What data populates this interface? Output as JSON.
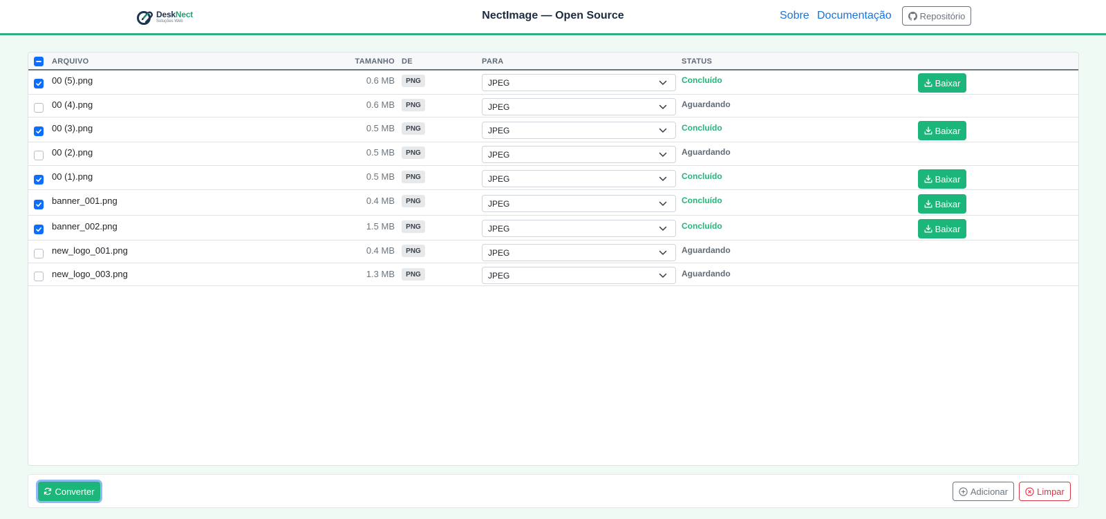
{
  "header": {
    "logo": {
      "name_part1": "Desk",
      "name_part2": "Nect",
      "subtitle": "Soluções Web"
    },
    "title": "NectImage — Open Source",
    "nav": {
      "sobre": "Sobre",
      "docs": "Documentação"
    },
    "repo_label": "Repositório"
  },
  "table": {
    "columns": {
      "file": "ARQUIVO",
      "size": "TAMANHO",
      "from": "DE",
      "to": "PARA",
      "status": "STATUS"
    },
    "rows": [
      {
        "name": "00 (5).png",
        "size": "0.6 MB",
        "from": "PNG",
        "to": "JPEG",
        "status": "Concluído",
        "checked": true,
        "download": "Baixar"
      },
      {
        "name": "00 (4).png",
        "size": "0.6 MB",
        "from": "PNG",
        "to": "JPEG",
        "status": "Aguardando",
        "checked": false,
        "download": ""
      },
      {
        "name": "00 (3).png",
        "size": "0.5 MB",
        "from": "PNG",
        "to": "JPEG",
        "status": "Concluído",
        "checked": true,
        "download": "Baixar"
      },
      {
        "name": "00 (2).png",
        "size": "0.5 MB",
        "from": "PNG",
        "to": "JPEG",
        "status": "Aguardando",
        "checked": false,
        "download": ""
      },
      {
        "name": "00 (1).png",
        "size": "0.5 MB",
        "from": "PNG",
        "to": "JPEG",
        "status": "Concluído",
        "checked": true,
        "download": "Baixar"
      },
      {
        "name": "banner_001.png",
        "size": "0.4 MB",
        "from": "PNG",
        "to": "JPEG",
        "status": "Concluído",
        "checked": true,
        "download": "Baixar"
      },
      {
        "name": "banner_002.png",
        "size": "1.5 MB",
        "from": "PNG",
        "to": "JPEG",
        "status": "Concluído",
        "checked": true,
        "download": "Baixar"
      },
      {
        "name": "new_logo_001.png",
        "size": "0.4 MB",
        "from": "PNG",
        "to": "JPEG",
        "status": "Aguardando",
        "checked": false,
        "download": ""
      },
      {
        "name": "new_logo_003.png",
        "size": "1.3 MB",
        "from": "PNG",
        "to": "JPEG",
        "status": "Aguardando",
        "checked": false,
        "download": ""
      }
    ]
  },
  "footer": {
    "convert_label": "Converter",
    "add_label": "Adicionar",
    "clear_label": "Limpar"
  },
  "colors": {
    "accent_green": "#1cb67a",
    "primary_blue": "#0d6efd",
    "danger_red": "#dc3545",
    "header_border": "#2fae7f"
  },
  "icons": {
    "logo": "paperclip-icon",
    "repo": "github-icon",
    "download": "download-icon",
    "convert": "refresh-icon",
    "add": "plus-circle-icon",
    "clear": "x-circle-icon"
  }
}
